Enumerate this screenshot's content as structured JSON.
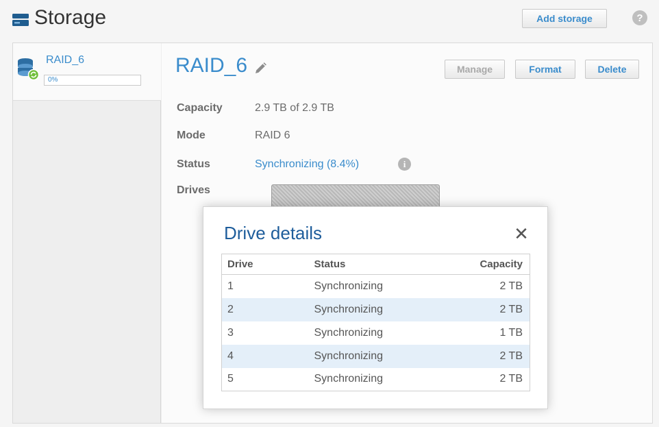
{
  "header": {
    "title": "Storage",
    "add_storage_label": "Add storage",
    "help_glyph": "?"
  },
  "sidebar": {
    "items": [
      {
        "label": "RAID_6",
        "progress_text": "0%",
        "progress": 0
      }
    ]
  },
  "volume": {
    "name": "RAID_6",
    "actions": {
      "manage_label": "Manage",
      "format_label": "Format",
      "delete_label": "Delete"
    },
    "fields": {
      "capacity_label": "Capacity",
      "capacity_value": "2.9 TB of 2.9 TB",
      "mode_label": "Mode",
      "mode_value": "RAID 6",
      "status_label": "Status",
      "status_value": "Synchronizing (8.4%)",
      "drives_label": "Drives"
    }
  },
  "modal": {
    "title": "Drive details",
    "close_glyph": "✕",
    "columns": [
      "Drive",
      "Status",
      "Capacity"
    ],
    "rows": [
      {
        "drive": "1",
        "status": "Synchronizing",
        "capacity": "2 TB"
      },
      {
        "drive": "2",
        "status": "Synchronizing",
        "capacity": "2 TB"
      },
      {
        "drive": "3",
        "status": "Synchronizing",
        "capacity": "1 TB"
      },
      {
        "drive": "4",
        "status": "Synchronizing",
        "capacity": "2 TB"
      },
      {
        "drive": "5",
        "status": "Synchronizing",
        "capacity": "2 TB"
      }
    ]
  },
  "colors": {
    "accent": "#3a8ccc",
    "modal_title": "#1e5d9b",
    "alt_row": "#e4eff9"
  },
  "icons": {
    "header": "storage-icon",
    "sidebar": "raid-volume-icon",
    "edit": "pencil-icon",
    "info": "info-icon",
    "help": "help-icon",
    "close": "close-icon"
  }
}
